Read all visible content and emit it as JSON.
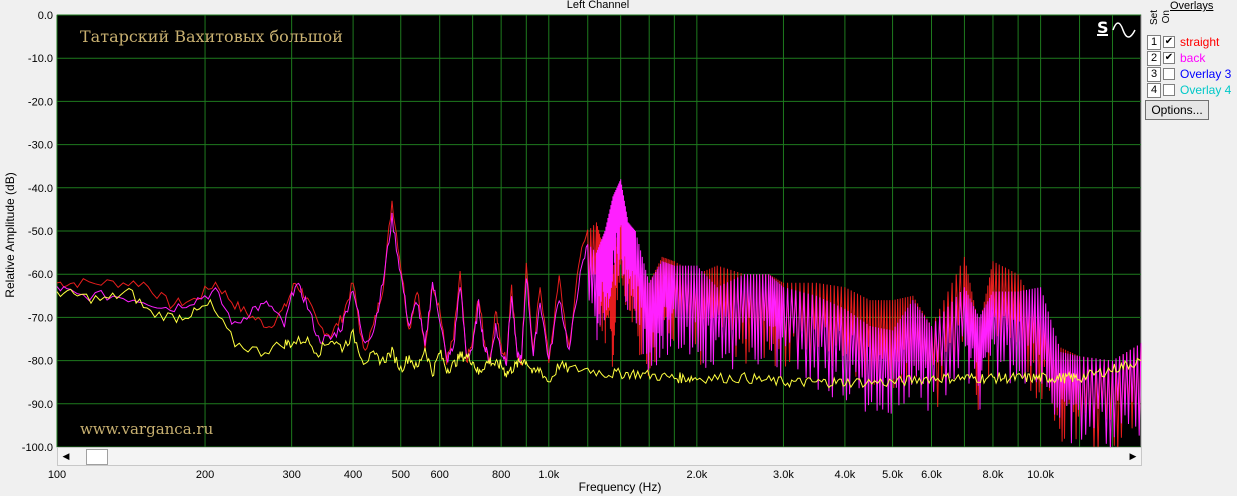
{
  "window": {
    "title": "Left Channel"
  },
  "watermark": {
    "top": "Татарский Вахитовых большой",
    "bottom": "www.varganca.ru"
  },
  "tools": {
    "s_icon": "s-icon",
    "wave_icon": "sine-wave-icon"
  },
  "panel": {
    "title": "Overlays",
    "set_label": "Set",
    "on_label": "On",
    "options_label": "Options...",
    "overlays": [
      {
        "num": "1",
        "checked": true,
        "label": "straight",
        "color": "#ff0000"
      },
      {
        "num": "2",
        "checked": true,
        "label": "back",
        "color": "#ff00ff"
      },
      {
        "num": "3",
        "checked": false,
        "label": "Overlay 3",
        "color": "#0000ff"
      },
      {
        "num": "4",
        "checked": false,
        "label": "Overlay 4",
        "color": "#00c8c8"
      }
    ]
  },
  "chart_data": {
    "type": "line",
    "title": "Left Channel",
    "xlabel": "Frequency (Hz)",
    "ylabel": "Relative Amplitude (dB)",
    "x_scale": "log",
    "xlim": [
      100,
      16000
    ],
    "ylim": [
      -100,
      0
    ],
    "grid": true,
    "y_ticks": [
      "0.0",
      "-10.0",
      "-20.0",
      "-30.0",
      "-40.0",
      "-50.0",
      "-60.0",
      "-70.0",
      "-80.0",
      "-90.0",
      "-100.0"
    ],
    "y_tick_values": [
      0,
      -10,
      -20,
      -30,
      -40,
      -50,
      -60,
      -70,
      -80,
      -90,
      -100
    ],
    "x_ticks": [
      {
        "v": 100,
        "label": "100"
      },
      {
        "v": 200,
        "label": "200"
      },
      {
        "v": 300,
        "label": "300"
      },
      {
        "v": 400,
        "label": "400"
      },
      {
        "v": 500,
        "label": "500"
      },
      {
        "v": 600,
        "label": "600"
      },
      {
        "v": 800,
        "label": "800"
      },
      {
        "v": 1000,
        "label": "1.0k"
      },
      {
        "v": 2000,
        "label": "2.0k"
      },
      {
        "v": 3000,
        "label": "3.0k"
      },
      {
        "v": 4000,
        "label": "4.0k"
      },
      {
        "v": 5000,
        "label": "5.0k"
      },
      {
        "v": 6000,
        "label": "6.0k"
      },
      {
        "v": 8000,
        "label": "8.0k"
      },
      {
        "v": 10000,
        "label": "10.0k"
      }
    ],
    "x_minor": [
      700,
      900,
      1200,
      1400,
      1600,
      1800,
      7000,
      9000,
      12000,
      14000
    ],
    "series": [
      {
        "name": "straight",
        "color": "#ff2020",
        "x": [
          100,
          110,
          130,
          150,
          170,
          190,
          210,
          230,
          250,
          270,
          290,
          305,
          320,
          340,
          360,
          380,
          400,
          420,
          440,
          460,
          480,
          500,
          520,
          540,
          560,
          580,
          600,
          620,
          640,
          660,
          680,
          700,
          720,
          740,
          760,
          780,
          800,
          820,
          840,
          860,
          880,
          900,
          930,
          960,
          1000,
          1050,
          1100,
          1150,
          1200,
          1250,
          1300,
          1350,
          1400,
          1450,
          1500,
          1600,
          1700,
          1800,
          2000,
          2200,
          2500,
          2800,
          3000,
          3500,
          4000,
          4500,
          5000,
          5500,
          6000,
          7000,
          7500,
          8000,
          9000,
          10000,
          11000,
          12000,
          14000,
          16000
        ],
        "y": [
          -62,
          -62,
          -62,
          -62,
          -67,
          -66,
          -62,
          -67,
          -70,
          -72,
          -68,
          -62,
          -65,
          -72,
          -74,
          -70,
          -62,
          -78,
          -72,
          -63,
          -43,
          -58,
          -73,
          -63,
          -78,
          -62,
          -68,
          -80,
          -75,
          -60,
          -80,
          -76,
          -65,
          -76,
          -80,
          -68,
          -77,
          -80,
          -62,
          -78,
          -80,
          -57,
          -79,
          -62,
          -80,
          -61,
          -78,
          -57,
          -50,
          -48,
          -55,
          -60,
          -43,
          -52,
          -55,
          -62,
          -56,
          -57,
          -60,
          -58,
          -60,
          -60,
          -62,
          -62,
          -63,
          -66,
          -66,
          -65,
          -72,
          -56,
          -72,
          -57,
          -60,
          -70,
          -77,
          -79,
          -80,
          -76
        ]
      },
      {
        "name": "back",
        "color": "#ff20ff",
        "x": [
          100,
          110,
          130,
          150,
          170,
          190,
          210,
          230,
          250,
          270,
          290,
          305,
          320,
          340,
          360,
          380,
          400,
          420,
          440,
          460,
          480,
          500,
          520,
          540,
          560,
          580,
          600,
          620,
          640,
          660,
          680,
          700,
          720,
          740,
          760,
          780,
          800,
          820,
          840,
          860,
          880,
          900,
          930,
          960,
          1000,
          1050,
          1100,
          1150,
          1200,
          1250,
          1300,
          1350,
          1400,
          1450,
          1500,
          1600,
          1700,
          1800,
          2000,
          2200,
          2500,
          2800,
          3000,
          3500,
          4000,
          4500,
          5000,
          5500,
          6000,
          7000,
          7500,
          8000,
          9000,
          10000,
          11000,
          12000,
          14000,
          16000
        ],
        "y": [
          -63,
          -65,
          -65,
          -66,
          -68,
          -66,
          -64,
          -72,
          -68,
          -67,
          -72,
          -62,
          -66,
          -75,
          -75,
          -72,
          -63,
          -76,
          -73,
          -62,
          -47,
          -60,
          -72,
          -66,
          -77,
          -62,
          -70,
          -80,
          -77,
          -62,
          -79,
          -77,
          -67,
          -77,
          -80,
          -72,
          -78,
          -80,
          -65,
          -78,
          -80,
          -60,
          -79,
          -66,
          -80,
          -65,
          -78,
          -62,
          -53,
          -55,
          -50,
          -42,
          -38,
          -48,
          -50,
          -62,
          -57,
          -58,
          -58,
          -63,
          -60,
          -60,
          -63,
          -65,
          -68,
          -72,
          -73,
          -66,
          -72,
          -63,
          -70,
          -64,
          -64,
          -63,
          -78,
          -79,
          -80,
          -76
        ]
      },
      {
        "name": "",
        "color": "#ffff40",
        "x": [
          100,
          110,
          125,
          140,
          155,
          175,
          190,
          205,
          230,
          260,
          290,
          300,
          320,
          340,
          360,
          380,
          400,
          420,
          440,
          460,
          480,
          500,
          520,
          540,
          560,
          580,
          600,
          620,
          640,
          660,
          680,
          700,
          720,
          740,
          760,
          780,
          800,
          820,
          840,
          860,
          880,
          900,
          930,
          960,
          1000,
          1050,
          1100,
          1200,
          1300,
          1500,
          1800,
          2000,
          2500,
          3000,
          3500,
          4000,
          5000,
          6000,
          7000,
          8000,
          9000,
          10000,
          11000,
          12000,
          14000,
          16000
        ],
        "y": [
          -64,
          -65,
          -66,
          -64,
          -69,
          -70,
          -69,
          -67,
          -76,
          -78,
          -76,
          -76,
          -75,
          -78,
          -75,
          -77,
          -74,
          -80,
          -79,
          -80,
          -78,
          -82,
          -79,
          -82,
          -77,
          -83,
          -78,
          -82,
          -81,
          -79,
          -79,
          -80,
          -83,
          -81,
          -80,
          -81,
          -81,
          -83,
          -82,
          -81,
          -80,
          -80,
          -83,
          -82,
          -85,
          -81,
          -82,
          -82,
          -83,
          -83,
          -84,
          -84,
          -84,
          -85,
          -85,
          -85,
          -85,
          -84,
          -84,
          -84,
          -84,
          -84,
          -84,
          -84,
          -82,
          -80
        ]
      }
    ]
  }
}
